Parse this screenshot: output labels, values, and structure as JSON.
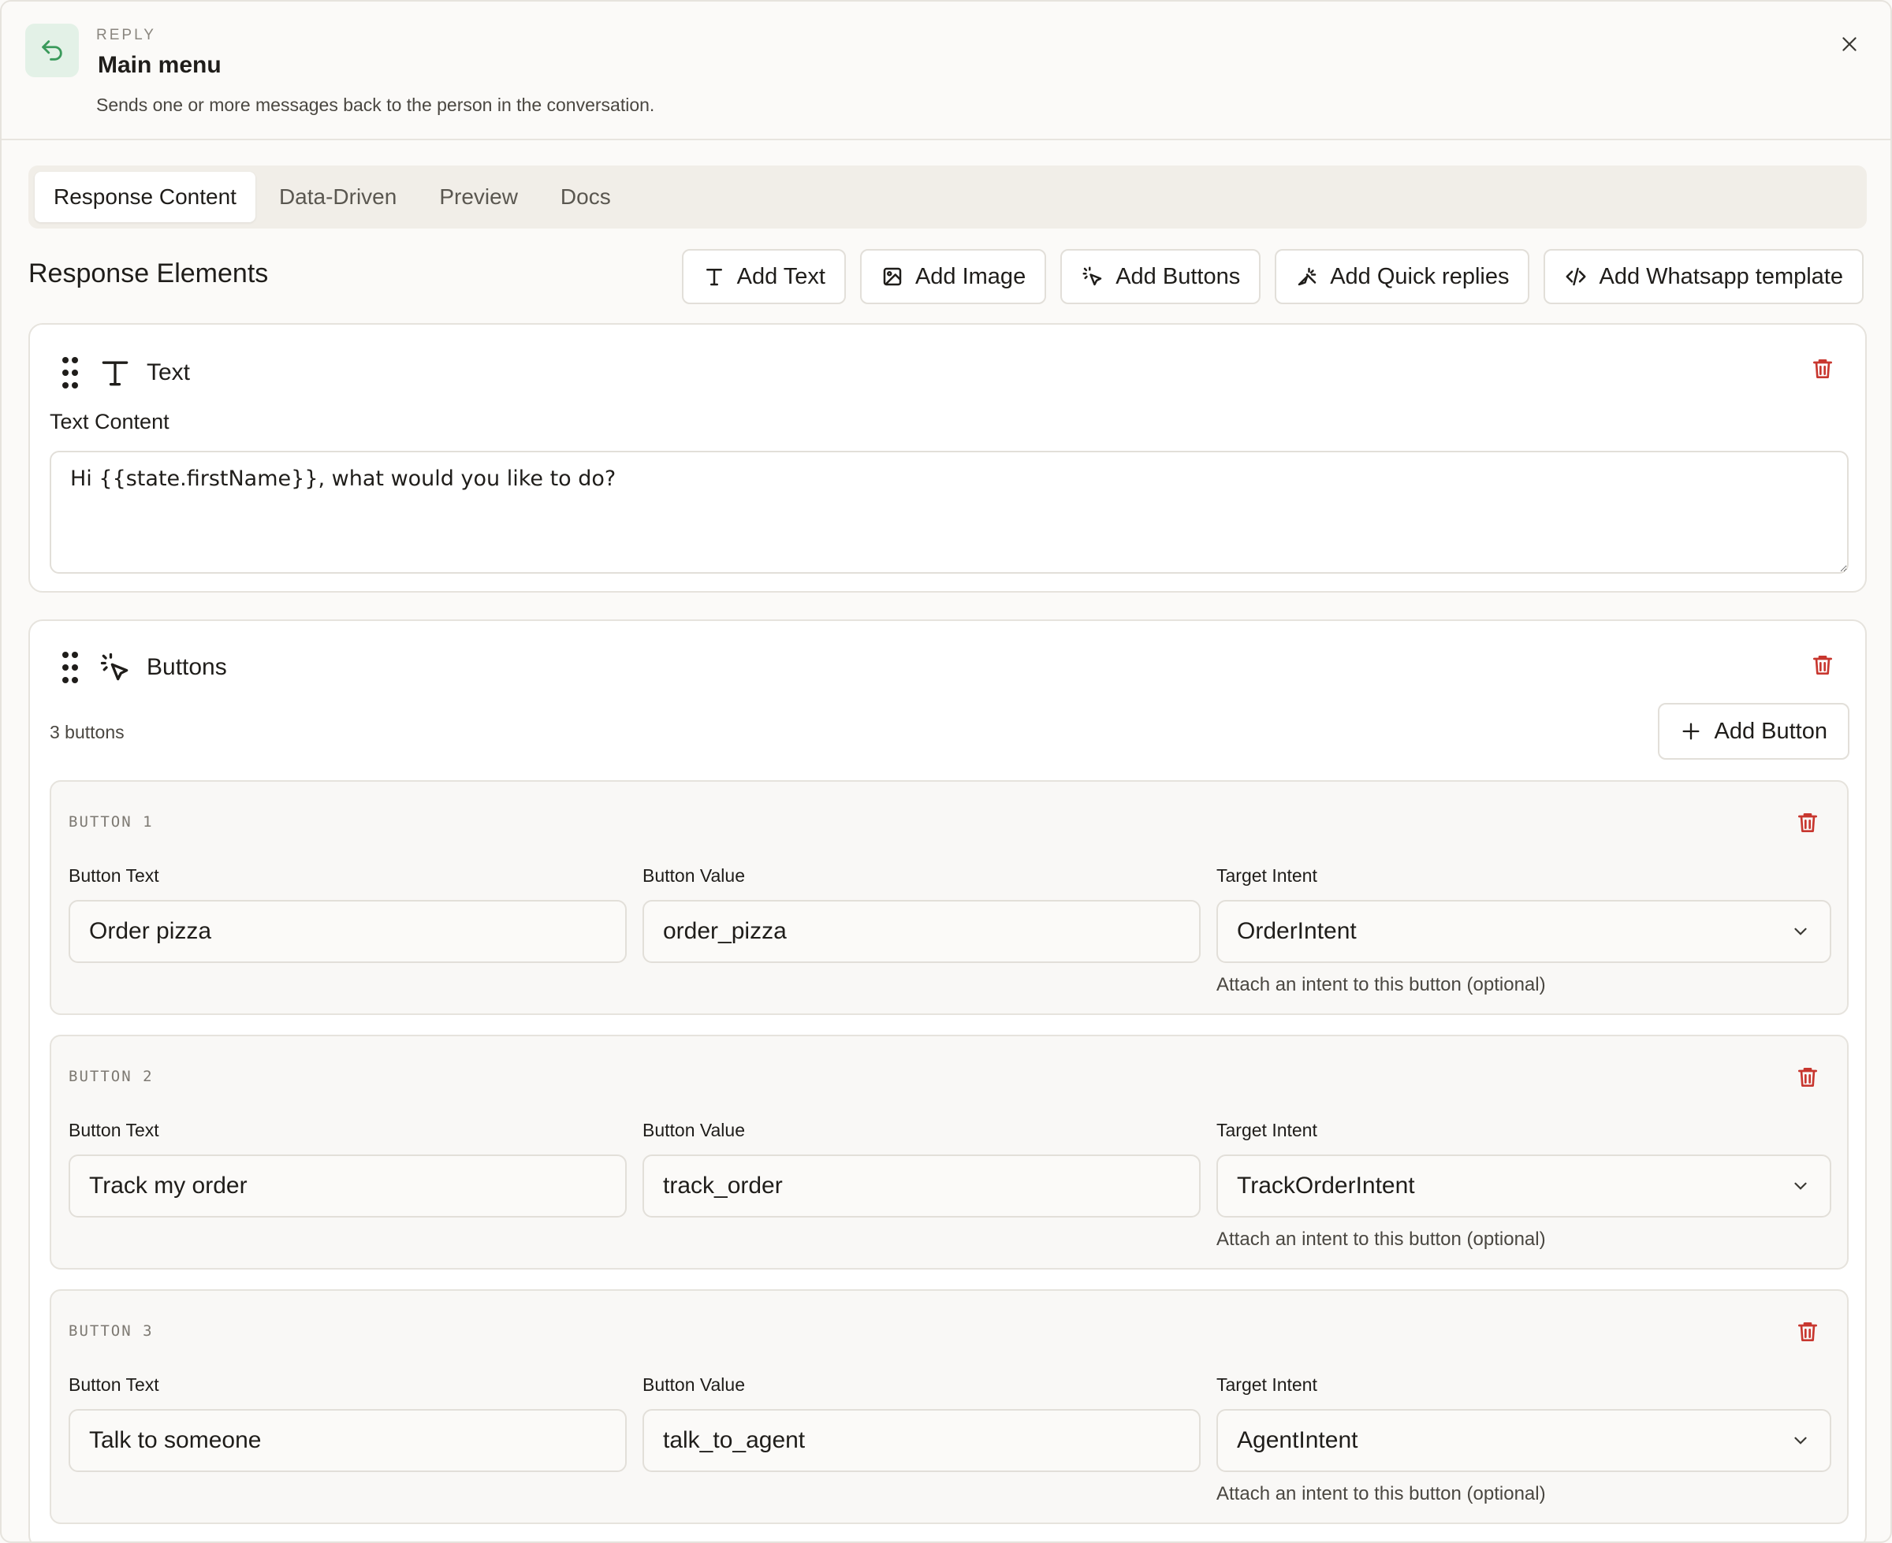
{
  "header": {
    "eyebrow": "REPLY",
    "title": "Main menu",
    "subtitle": "Sends one or more messages back to the person in the conversation.",
    "icon": "reply-arrow-icon",
    "accent": "#3a9a5b"
  },
  "tabs": [
    {
      "label": "Response Content",
      "active": true
    },
    {
      "label": "Data-Driven",
      "active": false
    },
    {
      "label": "Preview",
      "active": false
    },
    {
      "label": "Docs",
      "active": false
    }
  ],
  "section": {
    "title": "Response Elements"
  },
  "toolbar": {
    "add_text": "Add Text",
    "add_image": "Add Image",
    "add_buttons": "Add Buttons",
    "add_quick_replies": "Add Quick replies",
    "add_whatsapp": "Add Whatsapp template"
  },
  "text_card": {
    "label": "Text",
    "field_label": "Text Content",
    "value": "Hi {{state.firstName}}, what would you like to do?"
  },
  "buttons_card": {
    "label": "Buttons",
    "count": "3 buttons",
    "add_button": "Add Button",
    "field_labels": {
      "text": "Button Text",
      "value": "Button Value",
      "intent": "Target Intent"
    },
    "hint": "Attach an intent to this button (optional)",
    "items": [
      {
        "eyebrow": "BUTTON 1",
        "text": "Order pizza",
        "value": "order_pizza",
        "intent": "OrderIntent"
      },
      {
        "eyebrow": "BUTTON 2",
        "text": "Track my order",
        "value": "track_order",
        "intent": "TrackOrderIntent"
      },
      {
        "eyebrow": "BUTTON 3",
        "text": "Talk to someone",
        "value": "talk_to_agent",
        "intent": "AgentIntent"
      }
    ]
  },
  "colors": {
    "danger": "#c8372f",
    "border": "#e2dfd9"
  }
}
